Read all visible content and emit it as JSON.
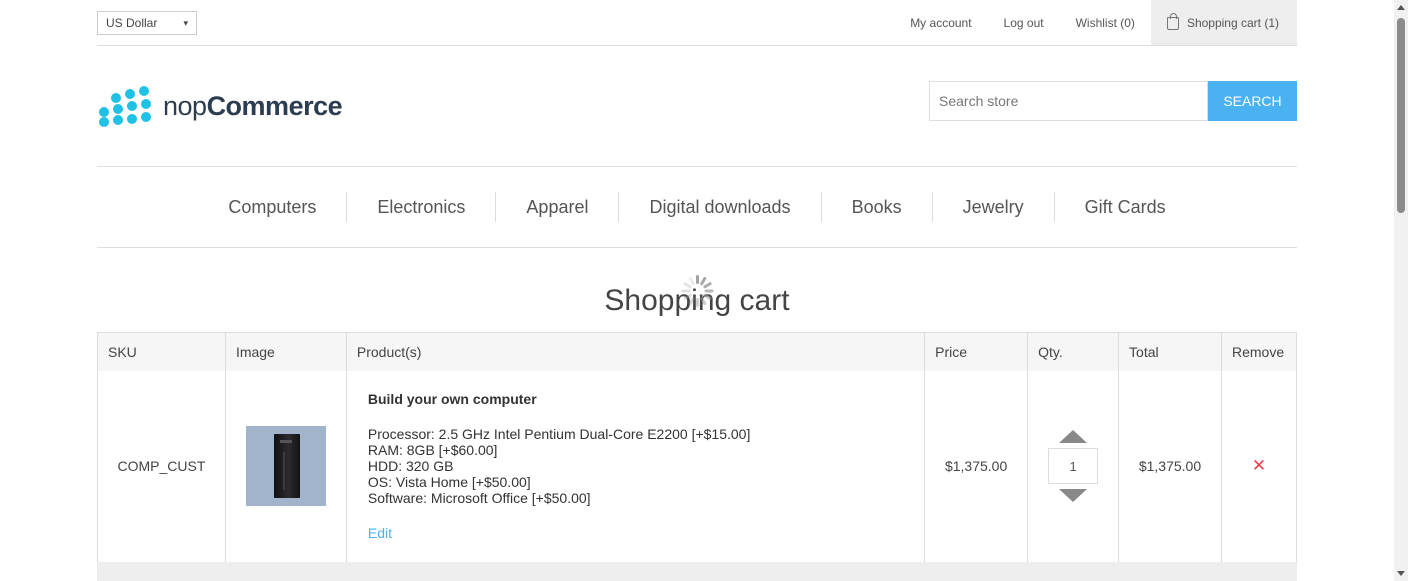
{
  "header": {
    "currency": "US Dollar",
    "links": {
      "my_account": "My account",
      "log_out": "Log out",
      "wishlist": "Wishlist (0)",
      "shopping_cart": "Shopping cart (1)"
    }
  },
  "logo": {
    "prefix": "nop",
    "suffix": "Commerce"
  },
  "search": {
    "placeholder": "Search store",
    "button": "SEARCH"
  },
  "menu": [
    "Computers",
    "Electronics",
    "Apparel",
    "Digital downloads",
    "Books",
    "Jewelry",
    "Gift Cards"
  ],
  "page_title": "Shopping cart",
  "table": {
    "headers": [
      "SKU",
      "Image",
      "Product(s)",
      "Price",
      "Qty.",
      "Total",
      "Remove"
    ],
    "rows": [
      {
        "sku": "COMP_CUST",
        "product_name": "Build your own computer",
        "attributes": [
          "Processor: 2.5 GHz Intel Pentium Dual-Core E2200 [+$15.00]",
          "RAM: 8GB [+$60.00]",
          "HDD: 320 GB",
          "OS: Vista Home [+$50.00]",
          "Software: Microsoft Office [+$50.00]"
        ],
        "edit_label": "Edit",
        "price": "$1,375.00",
        "qty": "1",
        "total": "$1,375.00",
        "remove_glyph": "✕"
      }
    ]
  },
  "colors": {
    "accent": "#4ab2f1",
    "logo_dots": "#1fc1e4",
    "remove": "#e4434b"
  },
  "icons": {
    "cart": "shopping-bag-icon",
    "remove": "close-icon"
  }
}
